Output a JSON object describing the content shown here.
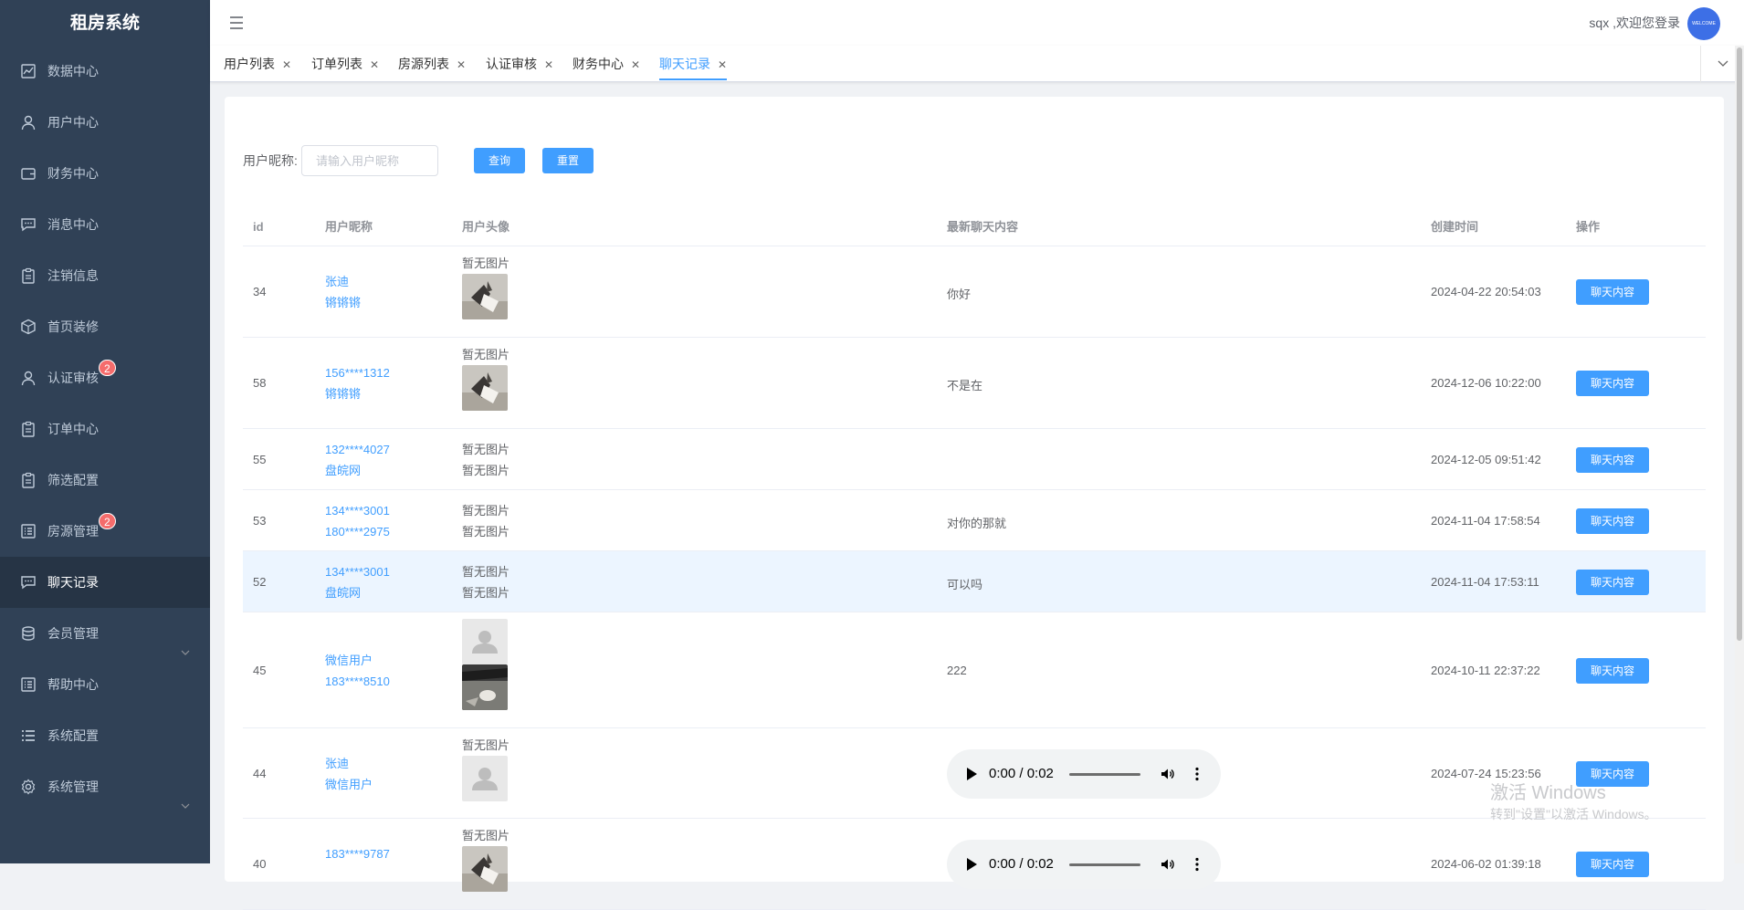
{
  "app": {
    "title": "租房系统"
  },
  "header": {
    "welcome": "sqx ,欢迎您登录",
    "avatar_text": "WELCOME"
  },
  "sidebar": {
    "items": [
      {
        "label": "数据中心",
        "icon": "chart-icon"
      },
      {
        "label": "用户中心",
        "icon": "user-icon"
      },
      {
        "label": "财务中心",
        "icon": "wallet-icon"
      },
      {
        "label": "消息中心",
        "icon": "message-icon"
      },
      {
        "label": "注销信息",
        "icon": "clipboard-icon"
      },
      {
        "label": "首页装修",
        "icon": "box-icon"
      },
      {
        "label": "认证审核",
        "icon": "user-icon",
        "badge": "2"
      },
      {
        "label": "订单中心",
        "icon": "clipboard-icon"
      },
      {
        "label": "筛选配置",
        "icon": "clipboard-icon"
      },
      {
        "label": "房源管理",
        "icon": "list-icon",
        "badge": "2"
      },
      {
        "label": "聊天记录",
        "icon": "message-icon",
        "active": true
      },
      {
        "label": "会员管理",
        "icon": "coins-icon",
        "has_submenu": true
      },
      {
        "label": "帮助中心",
        "icon": "list-icon"
      },
      {
        "label": "系统配置",
        "icon": "menu-list-icon"
      },
      {
        "label": "系统管理",
        "icon": "gear-icon",
        "has_submenu": true
      }
    ]
  },
  "tabs": [
    {
      "label": "用户列表"
    },
    {
      "label": "订单列表"
    },
    {
      "label": "房源列表"
    },
    {
      "label": "认证审核"
    },
    {
      "label": "财务中心"
    },
    {
      "label": "聊天记录",
      "active": true
    }
  ],
  "search": {
    "label": "用户昵称:",
    "placeholder": "请输入用户昵称",
    "query_label": "查询",
    "reset_label": "重置"
  },
  "table": {
    "columns": [
      "id",
      "用户昵称",
      "用户头像",
      "最新聊天内容",
      "创建时间",
      "操作"
    ],
    "no_image_text": "暂无图片",
    "action_label": "聊天内容",
    "rows": [
      {
        "id": "34",
        "user1": "张迪",
        "user2": "锵锵锵",
        "avatar1": "none",
        "avatar2": "photo",
        "message": "你好",
        "time": "2024-04-22 20:54:03"
      },
      {
        "id": "58",
        "user1": "156****1312",
        "user2": "锵锵锵",
        "avatar1": "none",
        "avatar2": "photo",
        "message": "不是在",
        "time": "2024-12-06 10:22:00"
      },
      {
        "id": "55",
        "user1": "132****4027",
        "user2": "盘皖网",
        "avatar1": "none",
        "avatar2": "none",
        "message": "",
        "time": "2024-12-05 09:51:42"
      },
      {
        "id": "53",
        "user1": "134****3001",
        "user2": "180****2975",
        "avatar1": "none",
        "avatar2": "none",
        "message": "对你的那就",
        "time": "2024-11-04 17:58:54"
      },
      {
        "id": "52",
        "user1": "134****3001",
        "user2": "盘皖网",
        "avatar1": "none",
        "avatar2": "none",
        "message": "可以吗",
        "time": "2024-11-04 17:53:11",
        "highlight": true
      },
      {
        "id": "45",
        "user1": "微信用户",
        "user2": "183****8510",
        "avatar1": "default",
        "avatar2": "cat",
        "message": "222",
        "time": "2024-10-11 22:37:22"
      },
      {
        "id": "44",
        "user1": "张迪",
        "user2": "微信用户",
        "avatar1": "none",
        "avatar2": "default",
        "message": "",
        "audio": "0:00 / 0:02",
        "time": "2024-07-24 15:23:56"
      },
      {
        "id": "40",
        "user1": "183****9787",
        "user2": "",
        "avatar1": "none",
        "avatar2": "photo",
        "message": "",
        "audio": "0:00 / 0:02",
        "time": "2024-06-02 01:39:18"
      }
    ]
  },
  "watermark": {
    "line1": "激活 Windows",
    "line2": "转到\"设置\"以激活 Windows。"
  }
}
